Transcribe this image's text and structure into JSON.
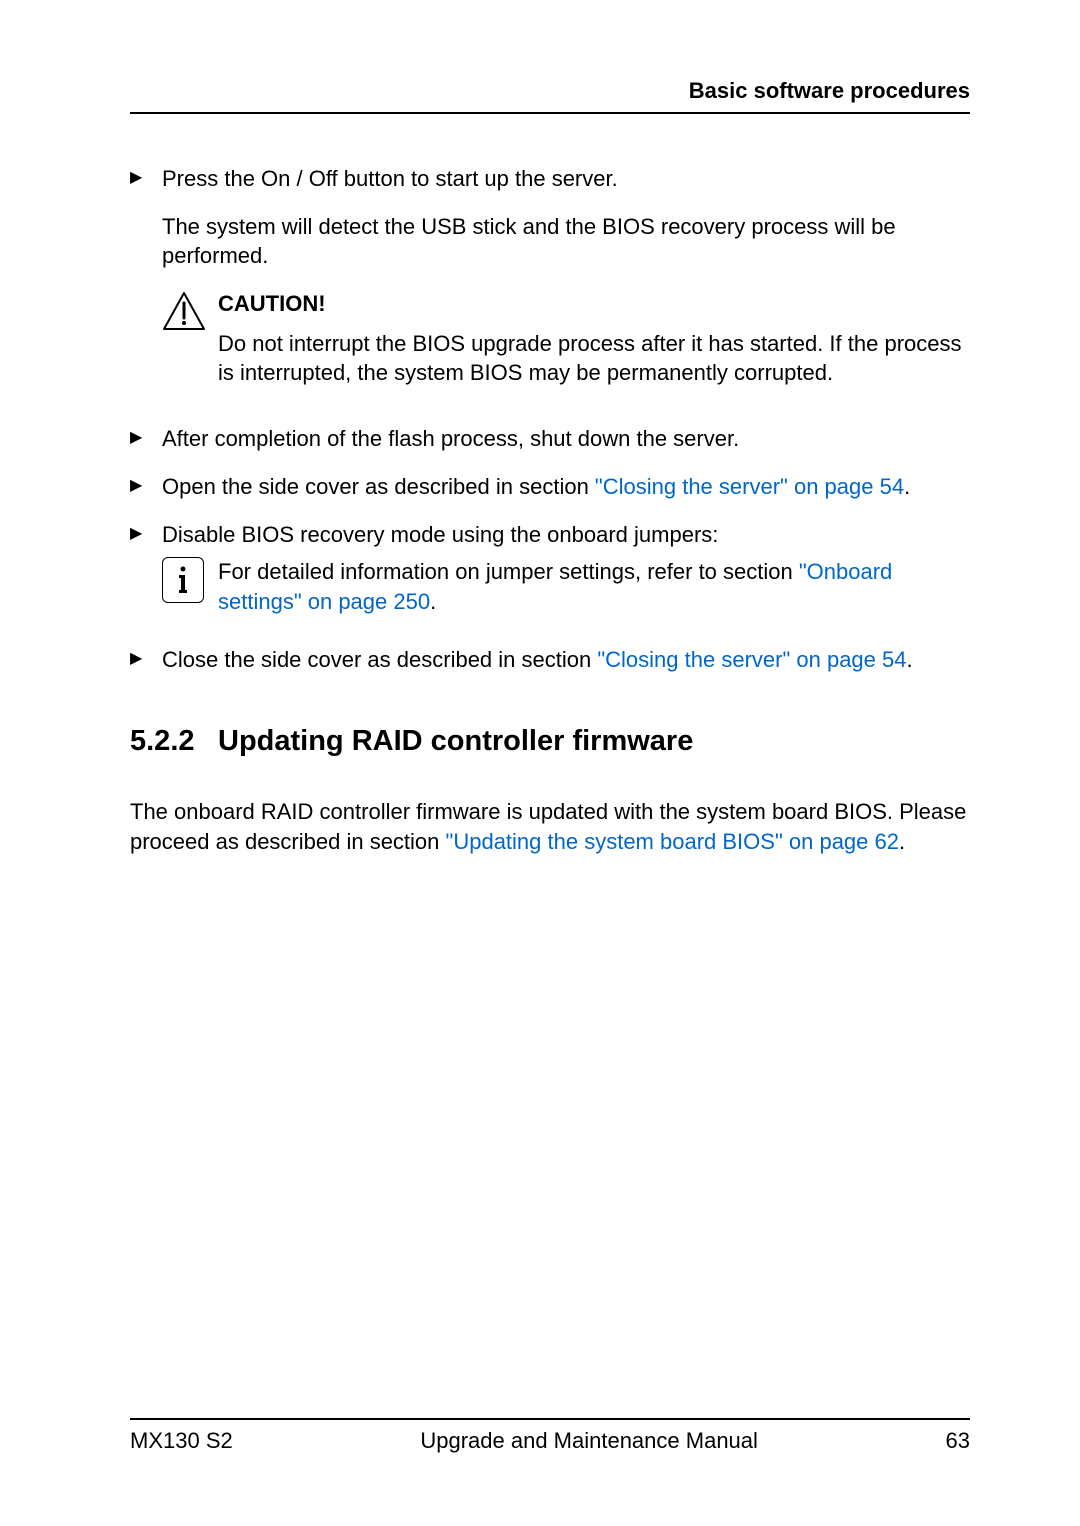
{
  "header": {
    "title": "Basic software procedures"
  },
  "bullets": {
    "b1": {
      "marker": "▶",
      "text": "Press the On / Off button to start up the server.",
      "para": "The system will detect the USB stick and the BIOS recovery process will be performed."
    },
    "caution": {
      "heading": "CAUTION!",
      "text": "Do not interrupt the BIOS upgrade process after it has started. If the process is interrupted, the system BIOS may be permanently corrupted."
    },
    "b2": {
      "marker": "▶",
      "text": "After completion of the flash process, shut down the server."
    },
    "b3": {
      "marker": "▶",
      "text_pre": "Open the side cover as described in section ",
      "link": "\"Closing the server\" on page 54",
      "text_post": "."
    },
    "b4": {
      "marker": "▶",
      "text": "Disable BIOS recovery mode using the onboard jumpers:"
    },
    "info": {
      "text_pre": "For detailed information on jumper settings, refer to section ",
      "link": "\"Onboard settings\" on page 250",
      "text_post": "."
    },
    "b5": {
      "marker": "▶",
      "text_pre": "Close the side cover as described in section ",
      "link": "\"Closing the server\" on page 54",
      "text_post": "."
    }
  },
  "section": {
    "number": "5.2.2",
    "title": "Updating RAID controller firmware",
    "para_pre": "The onboard RAID controller firmware is updated with the system board BIOS. Please proceed as described in section ",
    "link": "\"Updating the system board BIOS\" on page 62",
    "para_post": "."
  },
  "footer": {
    "left": "MX130 S2",
    "center": "Upgrade and Maintenance Manual",
    "right": "63"
  },
  "icons": {
    "info_label": "i"
  }
}
